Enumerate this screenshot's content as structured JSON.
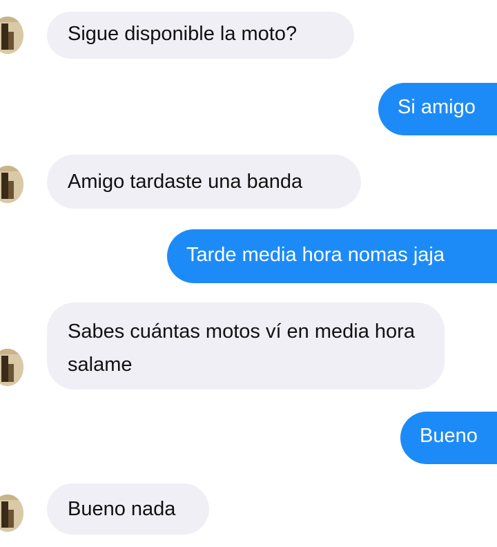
{
  "messages": [
    {
      "side": "received",
      "text": "Sigue disponible la moto?"
    },
    {
      "side": "sent",
      "text": "Si amigo"
    },
    {
      "side": "received",
      "text": "Amigo tardaste una banda"
    },
    {
      "side": "sent",
      "text": "Tarde media hora nomas jaja"
    },
    {
      "side": "received",
      "text": "Sabes cuántas motos ví en media hora salame"
    },
    {
      "side": "sent",
      "text": "Bueno"
    },
    {
      "side": "received",
      "text": "Bueno nada"
    }
  ],
  "colors": {
    "sent_bubble": "#1d8bf7",
    "received_bubble": "#f0eff5",
    "background": "#ffffff"
  }
}
